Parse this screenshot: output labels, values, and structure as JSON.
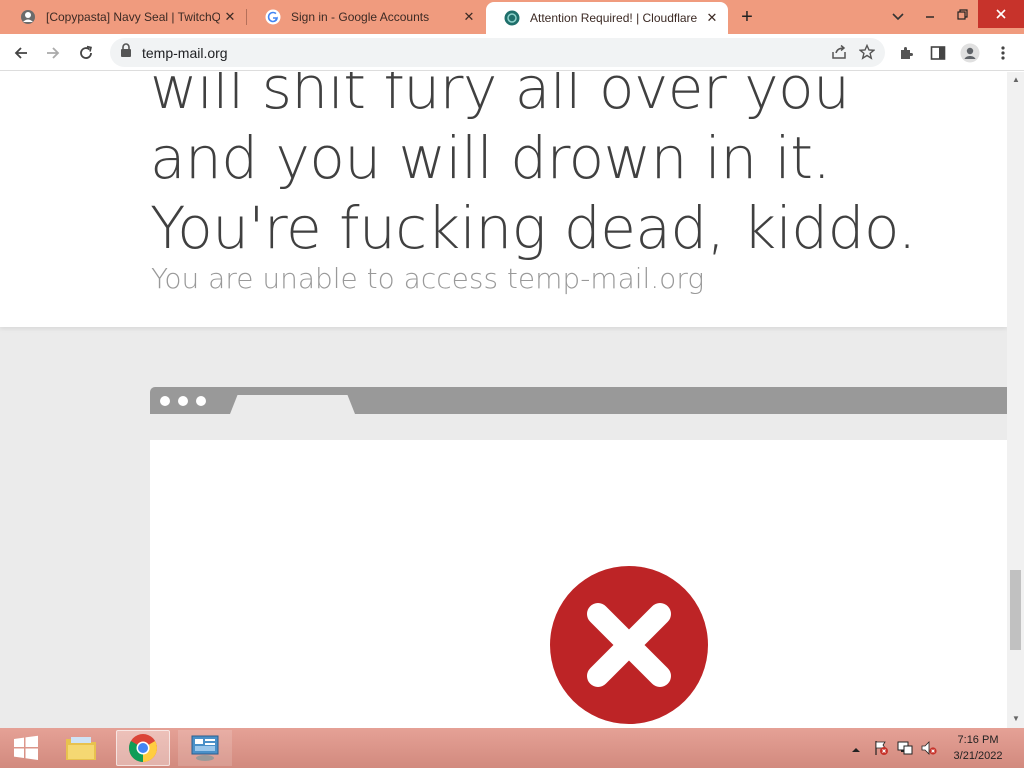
{
  "tabs": [
    {
      "title": "[Copypasta] Navy Seal | TwitchQ",
      "close": "✕",
      "favicon": "twitchquotes-icon"
    },
    {
      "title": "Sign in - Google Accounts",
      "close": "✕",
      "favicon": "google-g-icon"
    },
    {
      "title": "Attention Required! | Cloudflare",
      "close": "✕",
      "favicon": "cloudflare-icon",
      "active": true
    }
  ],
  "newtab_label": "+",
  "address_bar": {
    "url": "temp-mail.org"
  },
  "page": {
    "lines": [
      "will shit fury all over you",
      "and you will drown in it.",
      "You're fucking dead, kiddo."
    ],
    "subtitle": "You are unable to access temp-mail.org"
  },
  "taskbar": {
    "time": "7:16 PM",
    "date": "3/21/2022"
  },
  "colors": {
    "tabstrip": "#f09b7e",
    "error_red": "#bd2426",
    "taskbar": "#d98f84"
  }
}
